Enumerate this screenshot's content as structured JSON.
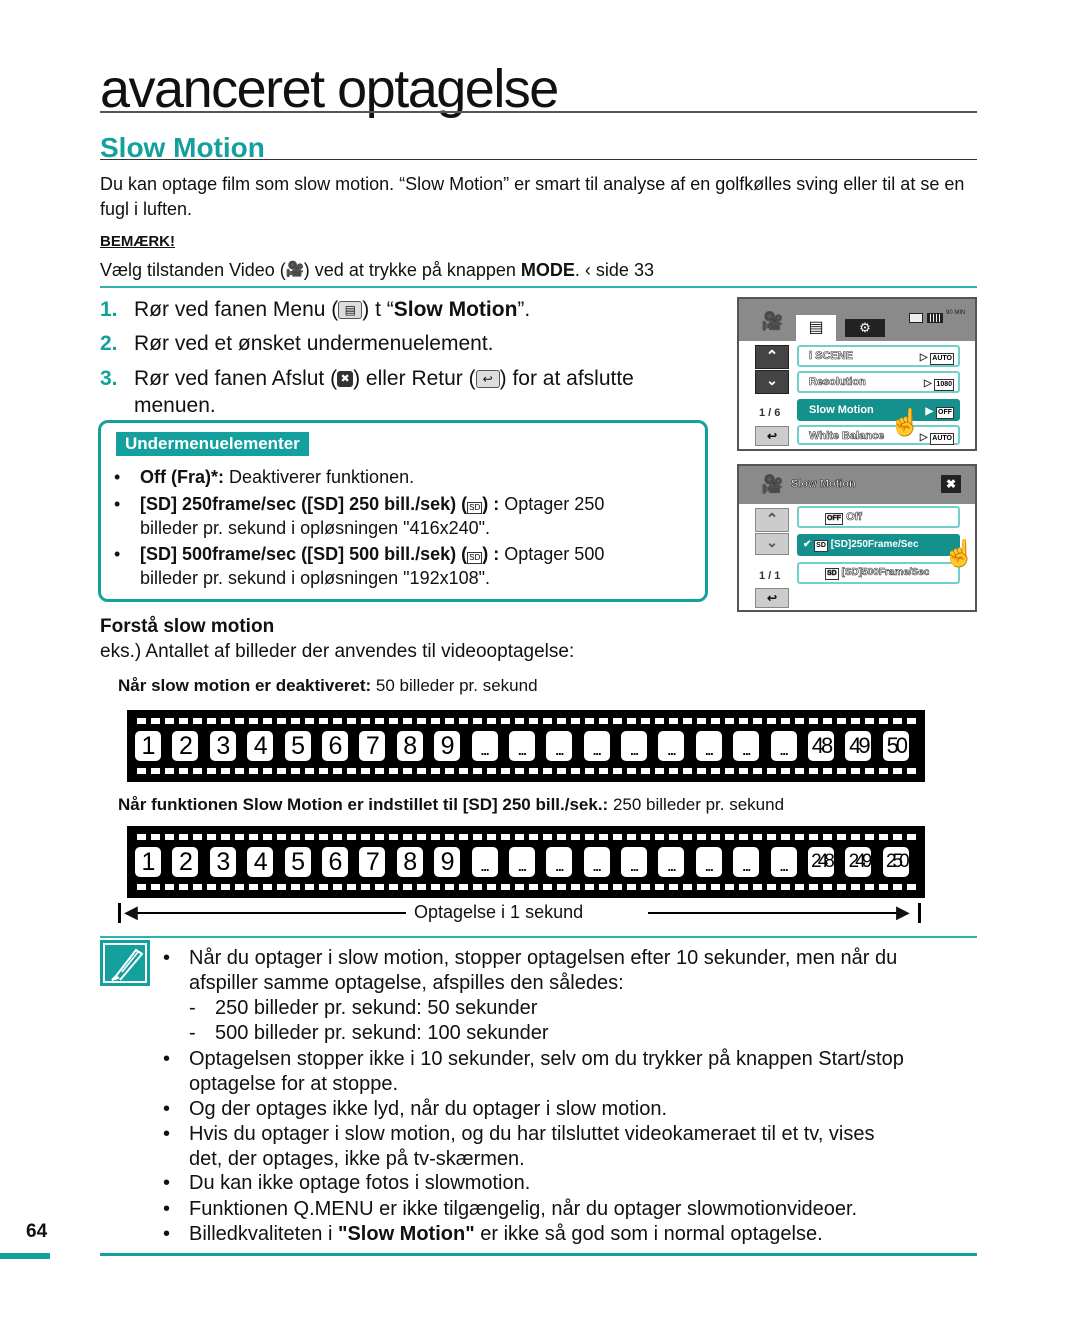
{
  "chapter_title": "avanceret optagelse",
  "section_title": "Slow Motion",
  "intro": "Du kan optage film som slow motion. “Slow Motion” er smart til analyse af en golfkølles sving eller til at se en fugl i luften.",
  "note": {
    "heading": "BEMÆRK!",
    "pre": "Vælg tilstanden Video (",
    "icon": "video-camera-icon",
    "mid": ") ved at trykke på knappen ",
    "bold": "MODE",
    "post": ".  ‹ side 33"
  },
  "steps": [
    {
      "num": "1.",
      "pre": "Rør ved fanen Menu (",
      "icon": "menu-icon",
      "mid": ")  t “",
      "bold": "Slow Motion",
      "post": "”."
    },
    {
      "num": "2.",
      "text": "Rør ved et ønsket undermenuelement."
    },
    {
      "num": "3.",
      "pre": "Rør ved fanen Afslut (",
      "icon1": "close-icon",
      "mid": ") eller Retur (",
      "icon2": "return-icon",
      "post": ") for at afslutte",
      "cont": "menuen."
    }
  ],
  "submenu": {
    "label": "Undermenuelementer",
    "items": [
      {
        "bold": "Off (Fra)*:",
        "text": " Deaktiverer funktionen."
      },
      {
        "bold": "[SD] 250frame/sec ([SD] 250 bill./sek) (",
        "bold_post": ") :",
        "text": " Optager 250",
        "cont": "billeder pr. sekund i opløsningen \"416x240\"."
      },
      {
        "bold": "[SD] 500frame/sec ([SD] 500 bill./sek) (",
        "bold_post": ") :",
        "text": " Optager 500",
        "cont": "billeder pr. sekund i opløsningen \"192x108\"."
      }
    ]
  },
  "screen1": {
    "tabs": [
      "video-camera-icon",
      "menu-icon",
      "settings-gear-icon"
    ],
    "status_icons": [
      "memory-card-icon",
      "battery-icon",
      "90 MIN"
    ],
    "page": "1 / 6",
    "rows": [
      {
        "label": "i SCENE",
        "value": "AUTO",
        "selected": false
      },
      {
        "label": "Resolution",
        "value": "1080",
        "selected": false
      },
      {
        "label": "Slow Motion",
        "value": "OFF",
        "selected": true
      },
      {
        "label": "White Balance",
        "value": "AUTO",
        "selected": false
      }
    ]
  },
  "screen2": {
    "title": "Slow Motion",
    "page": "1 / 1",
    "rows": [
      {
        "label": "Off",
        "selected": false,
        "checked": false
      },
      {
        "label": "[SD]250Frame/Sec",
        "selected": true,
        "checked": true
      },
      {
        "label": "[SD]500Frame/Sec",
        "selected": false,
        "checked": false
      }
    ]
  },
  "understand": {
    "heading": "Forstå slow motion",
    "text": "eks.) Antallet af billeder der anvendes til videooptagelse:"
  },
  "strip1": {
    "caption_bold": "Når slow motion er deaktiveret:",
    "caption": " 50 billeder pr. sekund",
    "frames": [
      "1",
      "2",
      "3",
      "4",
      "5",
      "6",
      "7",
      "8",
      "9",
      "...",
      "...",
      "...",
      "...",
      "...",
      "...",
      "...",
      "...",
      "...",
      "48",
      "49",
      "50"
    ]
  },
  "strip2": {
    "caption_bold": "Når funktionen Slow Motion er indstillet til [SD] 250 bill./sek.:",
    "caption": " 250 billeder pr. sekund",
    "frames": [
      "1",
      "2",
      "3",
      "4",
      "5",
      "6",
      "7",
      "8",
      "9",
      "...",
      "...",
      "...",
      "...",
      "...",
      "...",
      "...",
      "...",
      "...",
      "248",
      "249",
      "250"
    ]
  },
  "span_label": "Optagelse i 1 sekund",
  "tips": [
    {
      "text": "Når du optager i slow motion, stopper optagelsen efter 10 sekunder, men når du",
      "cont": "afspiller samme optagelse, afspilles den således:"
    },
    {
      "dash": "250 billeder pr. sekund: 50 sekunder"
    },
    {
      "dash": "500 billeder pr. sekund: 100 sekunder"
    },
    {
      "text": "Optagelsen stopper ikke i 10 sekunder, selv om du trykker på knappen Start/stop",
      "cont": "optagelse for at stoppe."
    },
    {
      "text": "Og der optages ikke lyd, når du optager i slow motion."
    },
    {
      "text": "Hvis du optager i slow motion, og du har tilsluttet videokameraet til et tv, vises",
      "cont": "det, der optages, ikke på tv-skærmen."
    },
    {
      "text": "Du kan ikke optage fotos i slowmotion."
    },
    {
      "text": "Funktionen Q.MENU er ikke tilgængelig, når du optager slowmotionvideoer."
    },
    {
      "pre": "Billedkvaliteten i ",
      "bold": "\"Slow Motion\"",
      "post": " er ikke så god som i normal optagelse."
    }
  ],
  "page_number": "64",
  "colors": {
    "accent": "#14a19e"
  }
}
